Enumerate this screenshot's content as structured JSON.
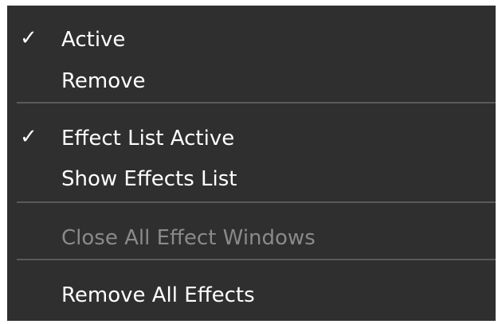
{
  "menu": {
    "items": [
      {
        "label": "Active",
        "checked": true,
        "check_glyph": "✓",
        "enabled": true
      },
      {
        "label": "Remove",
        "checked": false,
        "enabled": true
      },
      {
        "label": "Effect List Active",
        "checked": true,
        "check_glyph": "✓",
        "enabled": true
      },
      {
        "label": "Show Effects List",
        "checked": false,
        "enabled": true
      },
      {
        "label": "Close All Effect Windows",
        "checked": false,
        "enabled": false
      },
      {
        "label": "Remove All Effects",
        "checked": false,
        "enabled": true
      }
    ]
  }
}
